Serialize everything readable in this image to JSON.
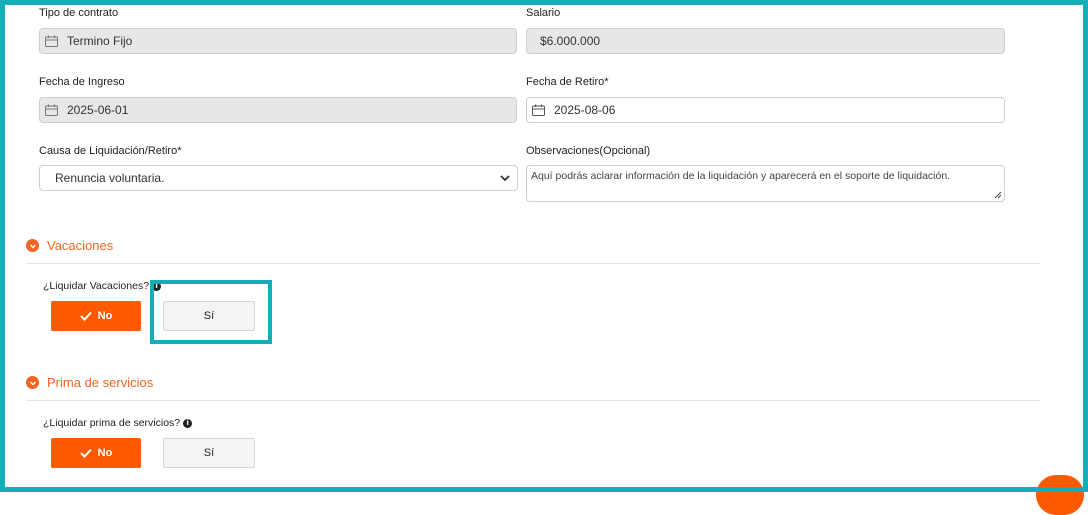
{
  "form": {
    "tipo_contrato": {
      "label": "Tipo de contrato",
      "value": "Termino Fijo"
    },
    "salario": {
      "label": "Salario",
      "value": "$6.000.000"
    },
    "fecha_ingreso": {
      "label": "Fecha de Ingreso",
      "value": "2025-06-01"
    },
    "fecha_retiro": {
      "label": "Fecha de Retiro*",
      "value": "2025-08-06"
    },
    "causa": {
      "label": "Causa de Liquidación/Retiro*",
      "value": "Renuncia voluntaria."
    },
    "observaciones": {
      "label": "Observaciones(Opcional)",
      "placeholder": "Aquí podrás aclarar información de la liquidación y aparecerá en el soporte de liquidación."
    }
  },
  "vacaciones": {
    "title": "Vacaciones",
    "question": "¿Liquidar Vacaciones?",
    "no_label": "No",
    "si_label": "Sí"
  },
  "prima": {
    "title": "Prima de servicios",
    "question": "¿Liquidar prima de servicios?",
    "no_label": "No",
    "si_label": "Sí"
  },
  "colors": {
    "accent": "#ff5a00",
    "section_title": "#f26522",
    "highlight": "#14adb8"
  },
  "icons": [
    "calendar-icon",
    "chevron-down-icon",
    "chevron-circle-icon",
    "info-icon",
    "check-icon",
    "resize-handle-icon"
  ]
}
